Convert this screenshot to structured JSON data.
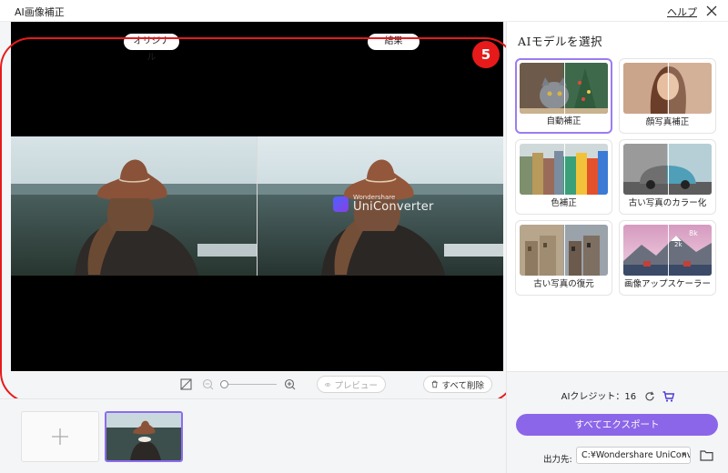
{
  "window": {
    "title": "AI画像補正",
    "help_label": "ヘルプ",
    "close_icon": "close-icon"
  },
  "preview": {
    "original_label": "オリジナル",
    "result_label": "結果",
    "watermark_brand": "Wondershare",
    "watermark_product": "UniConverter"
  },
  "annotation": {
    "badge": "5",
    "color": "#e61a1a"
  },
  "controls": {
    "fit_icon": "fit-screen-icon",
    "zoom_out_icon": "zoom-out-icon",
    "zoom_in_icon": "zoom-in-icon",
    "preview_label": "プレビュー",
    "delete_all_label": "すべて削除"
  },
  "thumbnails": {
    "add_icon": "plus-icon",
    "selected_index": 0
  },
  "models_panel": {
    "title": "AIモデルを選択",
    "models": [
      {
        "label": "自動補正",
        "selected": true
      },
      {
        "label": "顔写真補正",
        "selected": false
      },
      {
        "label": "色補正",
        "selected": false
      },
      {
        "label": "古い写真のカラー化",
        "selected": false
      },
      {
        "label": "古い写真の復元",
        "selected": false
      },
      {
        "label": "画像アップスケーラー",
        "selected": false
      }
    ]
  },
  "footer": {
    "credits_label": "AIクレジット：16",
    "refresh_icon": "refresh-icon",
    "cart_icon": "cart-icon",
    "export_label": "すべてエクスポート",
    "output_label": "出力先:",
    "output_path": "C:¥Wondershare UniConv",
    "folder_icon": "folder-icon"
  },
  "colors": {
    "accent": "#8c66e8",
    "selected_border": "#9b7cf2"
  }
}
